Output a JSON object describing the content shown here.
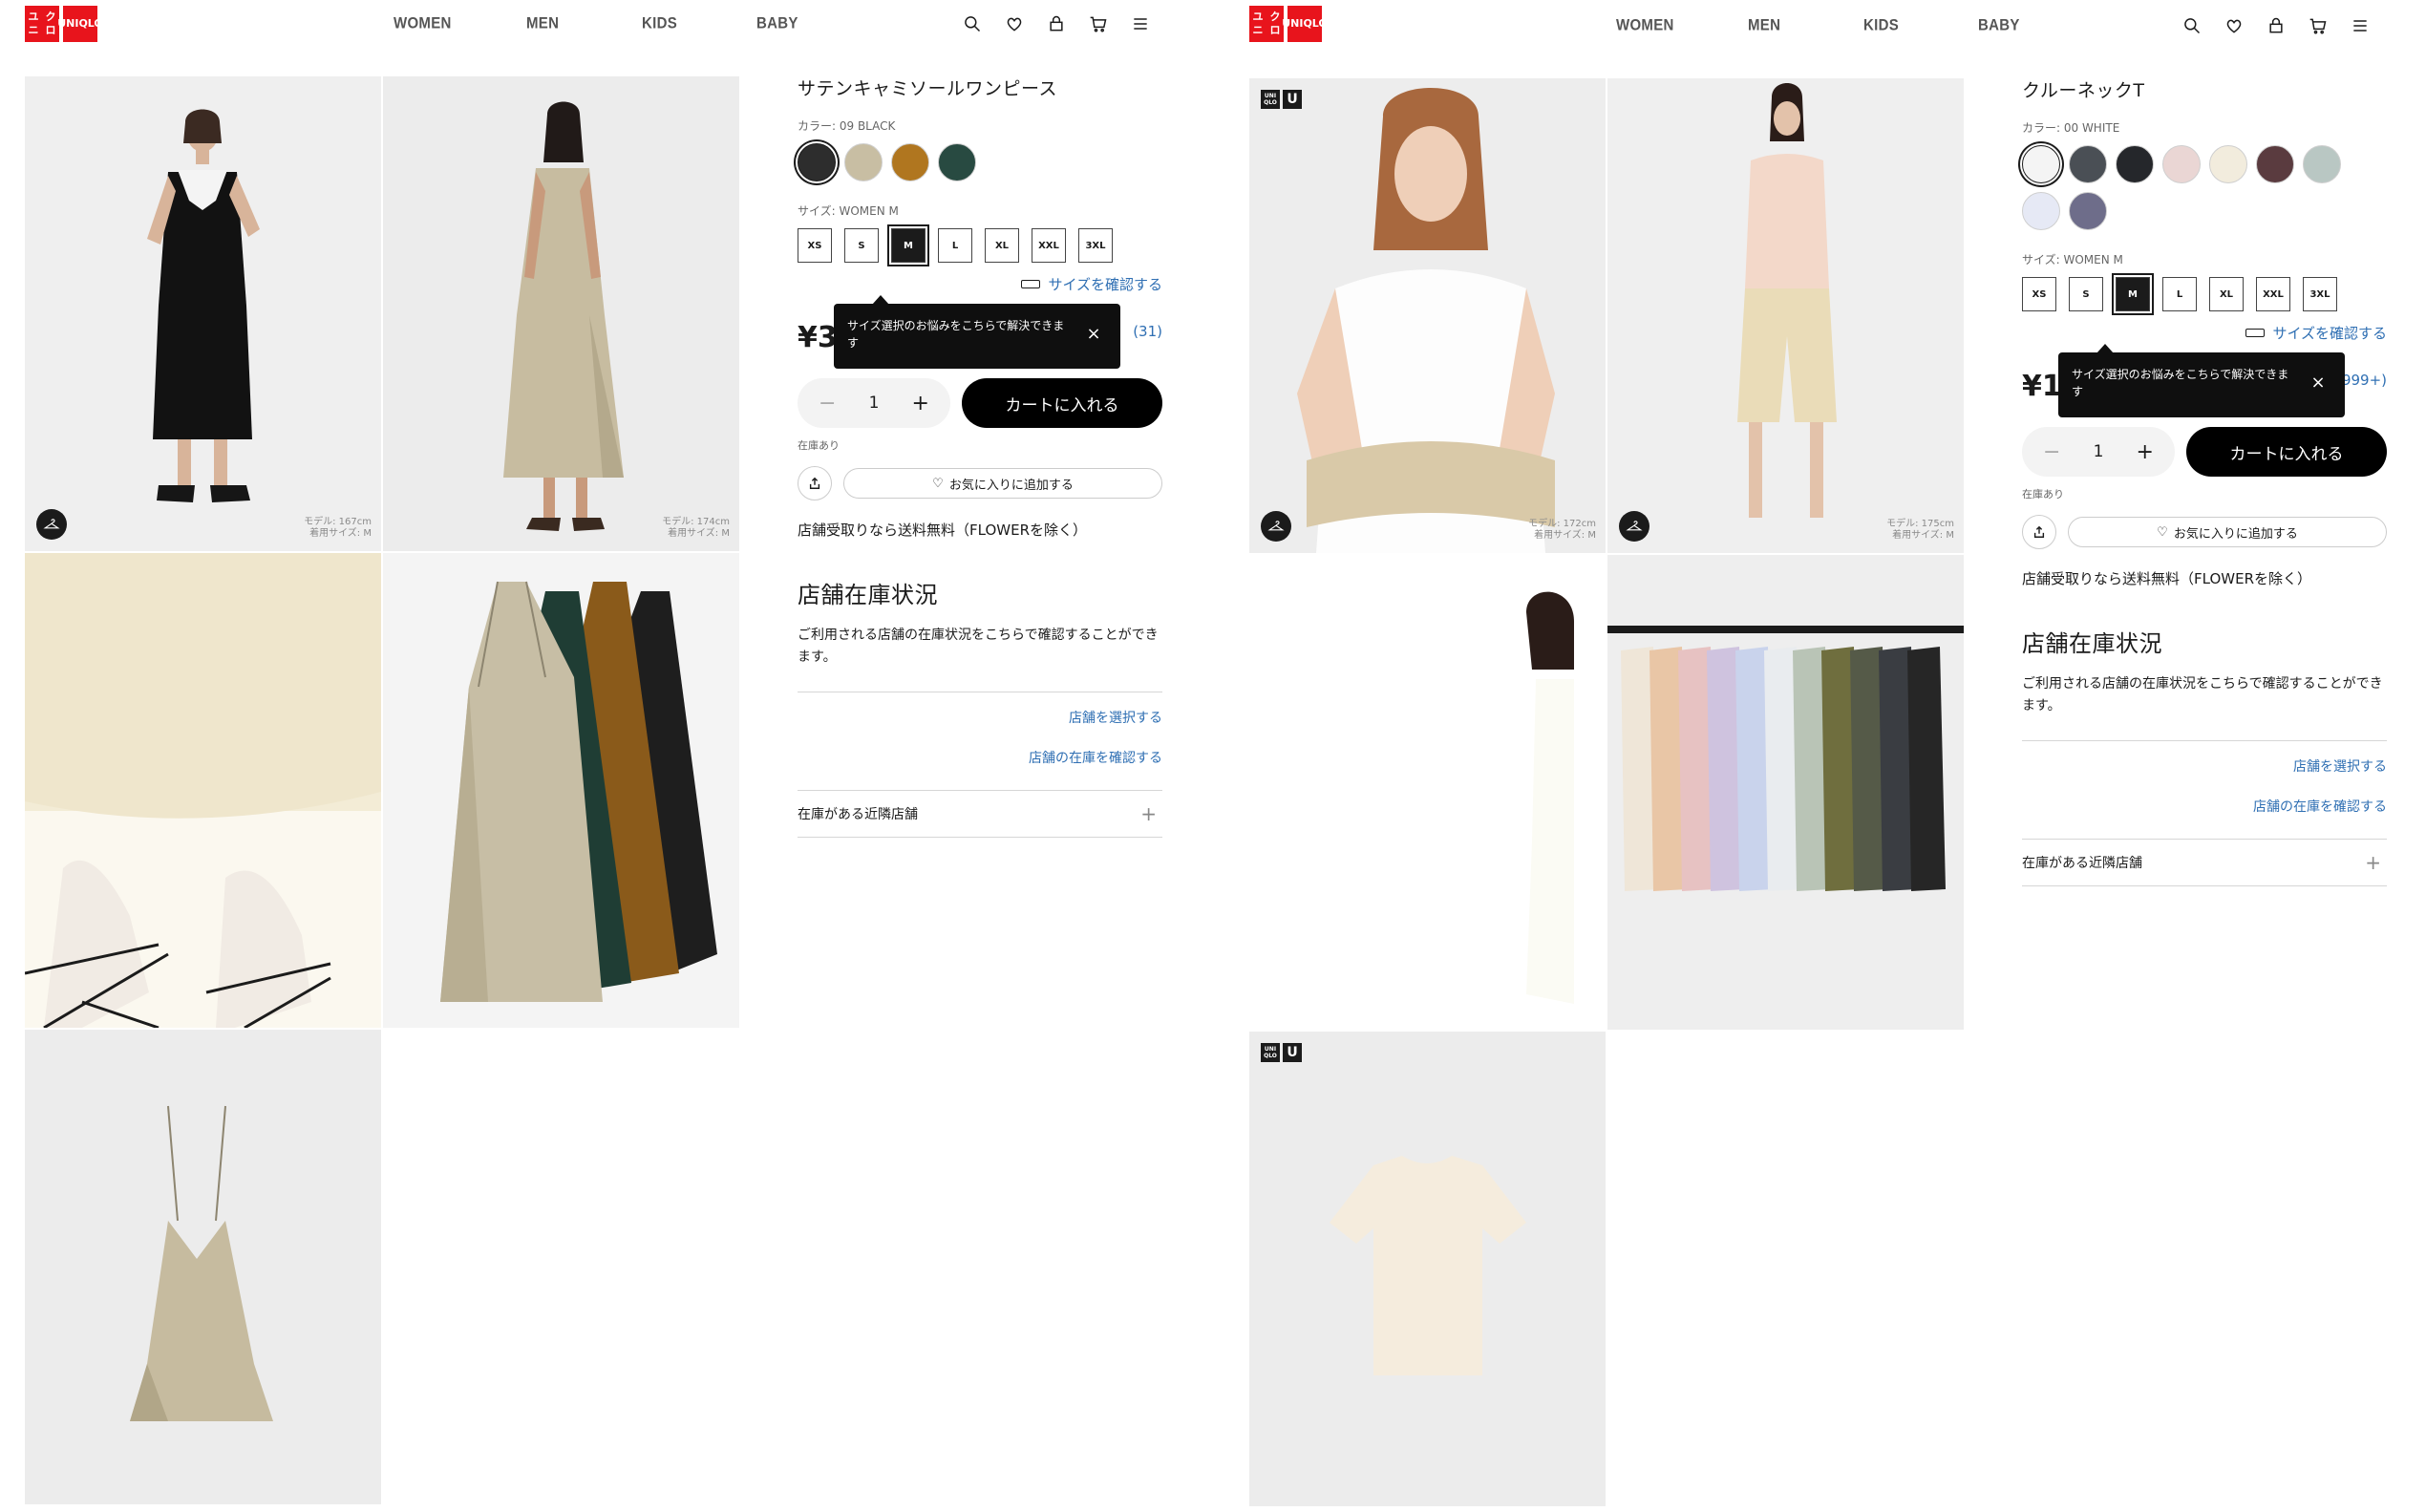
{
  "header": {
    "logo_top": "UNI",
    "logo_bottom": "QLO",
    "logo_kana_top": "ユニ",
    "logo_kana_bottom": "クロ",
    "nav": [
      "WOMEN",
      "MEN",
      "KIDS",
      "BABY"
    ],
    "icons": [
      "search-icon",
      "heart-icon",
      "account-icon",
      "cart-icon",
      "menu-icon"
    ]
  },
  "colors": {
    "brand": "#e8141c",
    "cart_button": "#000000",
    "link": "#2f6fb3"
  },
  "left": {
    "product_title": "サテンキャミソールワンピース",
    "color_label": "カラー: 09 BLACK",
    "swatches": [
      "#2d2d2d",
      "#c8bea3",
      "#b0761f",
      "#284a41"
    ],
    "selected_swatch": 0,
    "size_label": "サイズ: WOMEN M",
    "sizes": [
      "XS",
      "S",
      "M",
      "L",
      "XL",
      "XXL",
      "3XL"
    ],
    "selected_size": 2,
    "size_check": "サイズを確認する",
    "price": "¥3,",
    "reviews": "(31)",
    "tooltip": "サイズ選択のお悩みをこちらで解決できます",
    "tooltip_close": "×",
    "qty": "1",
    "qty_minus": "−",
    "qty_plus": "+",
    "cart_label": "カートに入れる",
    "stock": "在庫あり",
    "fav_label": "お気に入りに追加する",
    "shipping": "店舗受取りなら送料無料（FLOWERを除く）",
    "store_heading": "店舗在庫状況",
    "store_text": "ご利用される店舗の在庫状況をこちらで確認することができます。",
    "select_store": "店舗を選択する",
    "check_stock": "店舗の在庫を確認する",
    "nearby": "在庫がある近隣店舗",
    "nearby_plus": "+",
    "model_notes": [
      {
        "height": "モデル: 167cm",
        "size": "着用サイズ: M"
      },
      {
        "height": "モデル: 174cm",
        "size": "着用サイズ: M"
      }
    ]
  },
  "right": {
    "product_title": "クルーネックT",
    "color_label": "カラー: 00 WHITE",
    "swatches": [
      "#f4f4f4",
      "#4a4f55",
      "#25272b",
      "#ead6d4",
      "#f2ecdd",
      "#5a3b3f",
      "#b9c7c3",
      "#e6e9f5",
      "#6e6d8a"
    ],
    "selected_swatch": 0,
    "size_label": "サイズ: WOMEN M",
    "sizes": [
      "XS",
      "S",
      "M",
      "L",
      "XL",
      "XXL",
      "3XL"
    ],
    "selected_size": 2,
    "size_check": "サイズを確認する",
    "price": "¥1,",
    "reviews": "999+)",
    "tooltip": "サイズ選択のお悩みをこちらで解決できます",
    "tooltip_close": "×",
    "qty": "1",
    "qty_minus": "−",
    "qty_plus": "+",
    "cart_label": "カートに入れる",
    "stock": "在庫あり",
    "fav_label": "お気に入りに追加する",
    "shipping": "店舗受取りなら送料無料（FLOWERを除く）",
    "store_heading": "店舗在庫状況",
    "store_text": "ご利用される店舗の在庫状況をこちらで確認することができます。",
    "select_store": "店舗を選択する",
    "check_stock": "店舗の在庫を確認する",
    "nearby": "在庫がある近隣店舗",
    "nearby_plus": "+",
    "badge_small": "UNI QLO",
    "badge_u": "U",
    "model_notes": [
      {
        "height": "モデル: 172cm",
        "size": "着用サイズ: M"
      },
      {
        "height": "モデル: 175cm",
        "size": "着用サイズ: M"
      }
    ]
  }
}
